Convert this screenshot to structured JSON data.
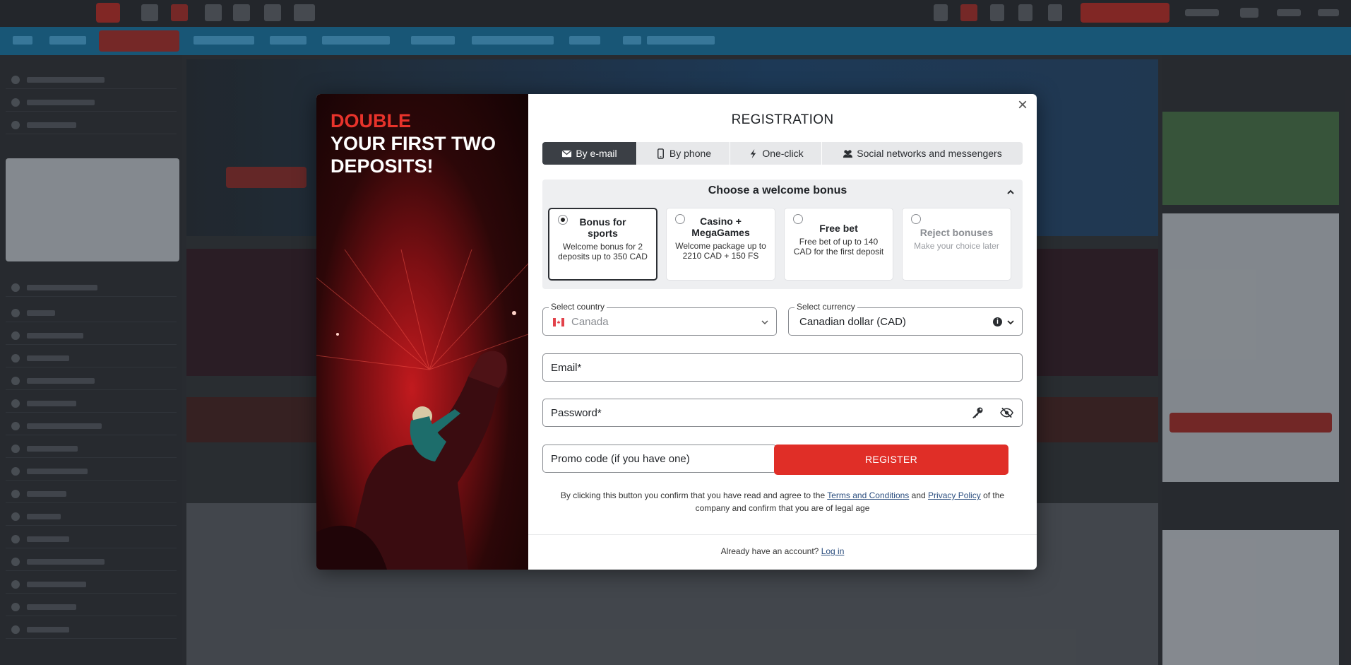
{
  "modal": {
    "promo": {
      "headline_accent": "DOUBLE",
      "headline_rest": "YOUR FIRST TWO DEPOSITS!"
    },
    "title": "REGISTRATION",
    "close_icon": "close-icon",
    "tabs": [
      {
        "label": "By e-mail",
        "icon": "envelope-icon",
        "active": true
      },
      {
        "label": "By phone",
        "icon": "phone-icon",
        "active": false
      },
      {
        "label": "One-click",
        "icon": "lightning-icon",
        "active": false
      },
      {
        "label": "Social networks and messengers",
        "icon": "users-icon",
        "active": false
      }
    ],
    "bonus": {
      "heading": "Choose a welcome bonus",
      "options": [
        {
          "title": "Bonus for sports",
          "desc": "Welcome bonus for 2 deposits up to 350 CAD",
          "selected": true
        },
        {
          "title": "Casino + MegaGames",
          "desc": "Welcome package up to 2210 CAD + 150 FS",
          "selected": false
        },
        {
          "title": "Free bet",
          "desc": "Free bet of up to 140 CAD for the first deposit",
          "selected": false
        },
        {
          "title": "Reject bonuses",
          "desc": "Make your choice later",
          "selected": false
        }
      ]
    },
    "country": {
      "label": "Select country",
      "value": "Canada"
    },
    "currency": {
      "label": "Select currency",
      "value": "Canadian dollar (CAD)"
    },
    "email": {
      "placeholder": "Email*"
    },
    "password": {
      "placeholder": "Password*"
    },
    "promo_code": {
      "placeholder": "Promo code (if you have one)"
    },
    "register_label": "REGISTER",
    "terms": {
      "prefix": "By clicking this button you confirm that you have read and agree to the",
      "terms_link": "Terms and Conditions",
      "and": "and",
      "privacy_link": "Privacy Policy",
      "suffix": "of the company and confirm that you are of legal age"
    },
    "login": {
      "prefix": "Already have an account?",
      "link": "Log in"
    }
  },
  "colors": {
    "accent": "#e02e27",
    "tab_active": "#3b3f45",
    "link": "#2a4d7e"
  }
}
